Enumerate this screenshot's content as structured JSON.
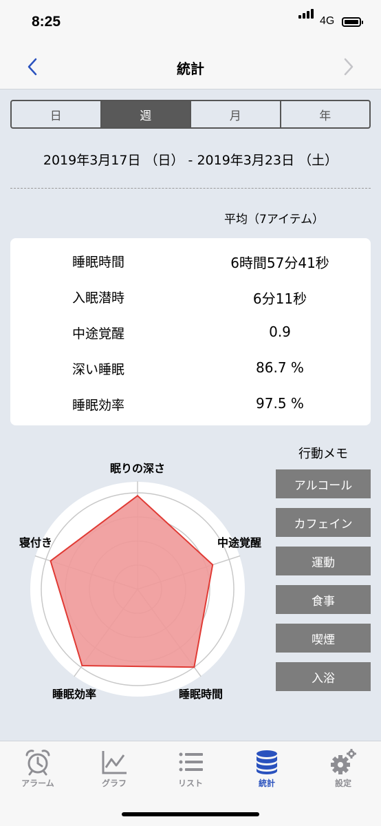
{
  "status": {
    "time": "8:25",
    "network": "4G"
  },
  "nav": {
    "title": "統計"
  },
  "segments": [
    "日",
    "週",
    "月",
    "年"
  ],
  "selected_segment": "週",
  "date_range": "2019年3月17日 （日） - 2019年3月23日 （土）",
  "average_label": "平均（7アイテム）",
  "stats": [
    {
      "label": "睡眠時間",
      "value": "6時間57分41秒"
    },
    {
      "label": "入眠潜時",
      "value": "6分11秒"
    },
    {
      "label": "中途覚醒",
      "value": "0.9"
    },
    {
      "label": "深い睡眠",
      "value": "86.7 %"
    },
    {
      "label": "睡眠効率",
      "value": "97.5 %"
    }
  ],
  "radar": {
    "axes": [
      "眠りの深さ",
      "中途覚醒",
      "睡眠時間",
      "睡眠効率",
      "寝付き"
    ],
    "values": [
      0.97,
      0.82,
      1.0,
      0.98,
      0.95
    ],
    "fill_color": "#f09999",
    "stroke_color": "#e03a34"
  },
  "memo": {
    "title": "行動メモ",
    "items": [
      "アルコール",
      "カフェイン",
      "運動",
      "食事",
      "喫煙",
      "入浴"
    ]
  },
  "tabs": [
    {
      "label": "アラーム",
      "icon": "alarm-clock-icon"
    },
    {
      "label": "グラフ",
      "icon": "line-chart-icon"
    },
    {
      "label": "リスト",
      "icon": "list-icon"
    },
    {
      "label": "統計",
      "icon": "database-icon"
    },
    {
      "label": "設定",
      "icon": "gear-icon"
    }
  ],
  "active_tab": "統計",
  "colors": {
    "accent": "#2a52be",
    "inactive": "#8e8e93",
    "background": "#e3e8ef"
  }
}
